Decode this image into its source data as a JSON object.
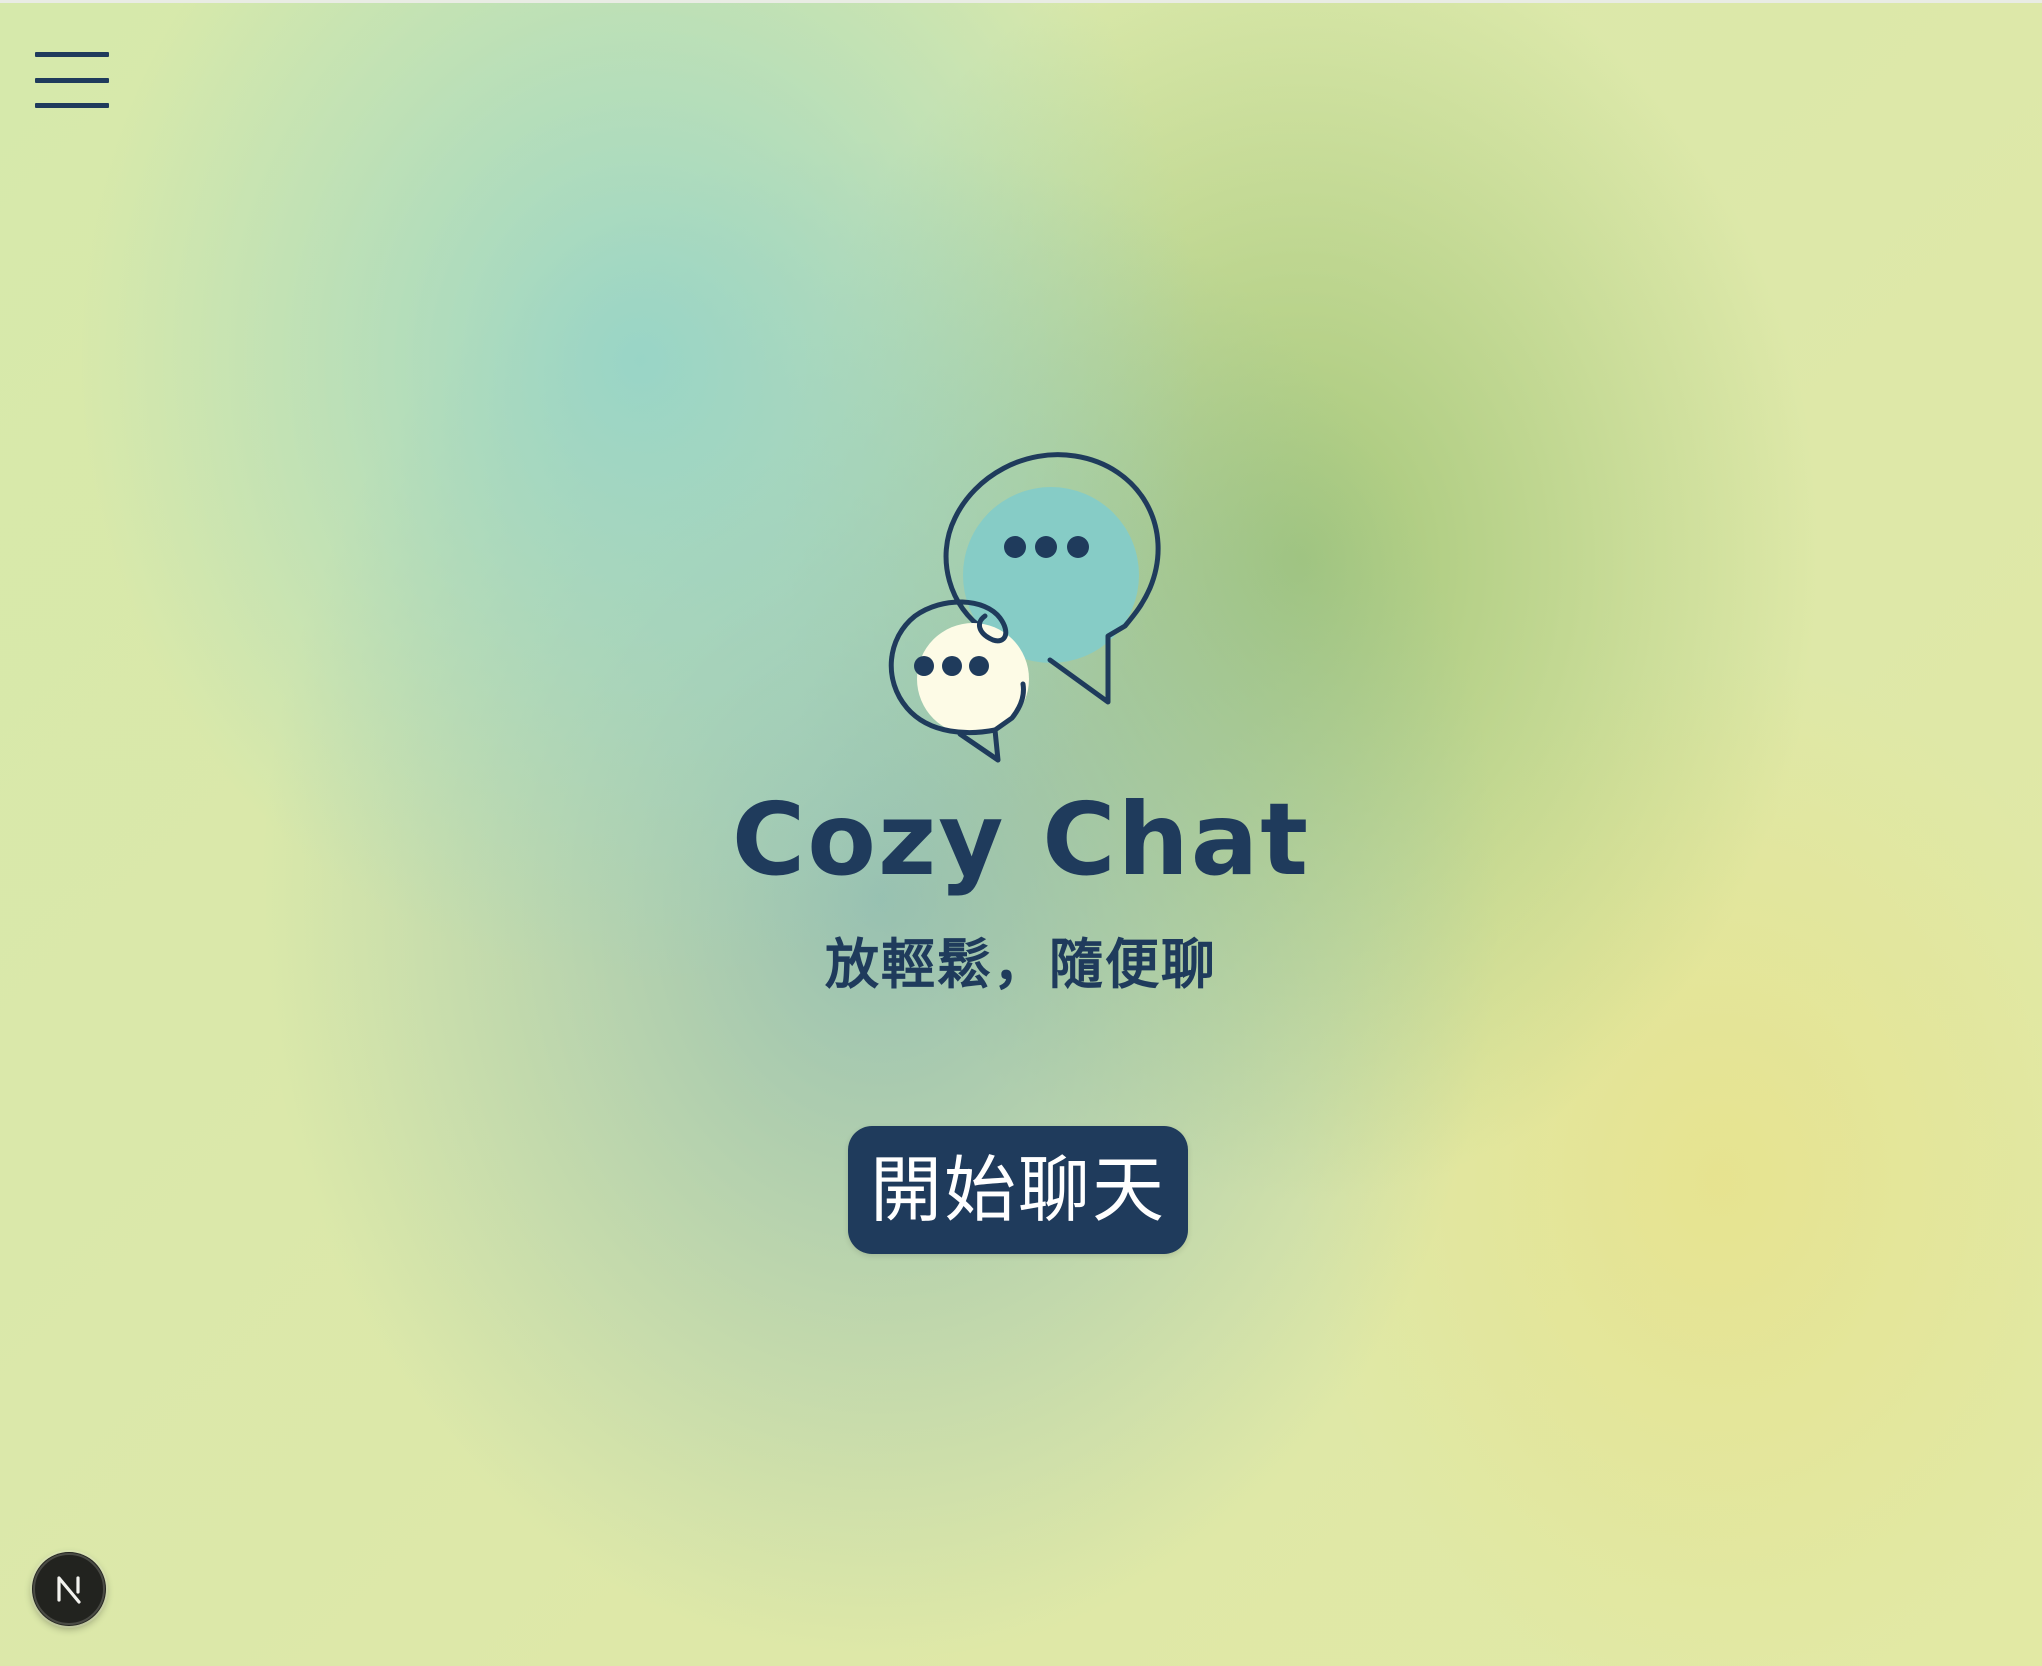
{
  "app": {
    "title": "Cozy Chat",
    "tagline": "放輕鬆，隨便聊"
  },
  "hero": {
    "logo_icon": "chat-bubbles-icon",
    "start_button_label": "開始聊天"
  },
  "nav": {
    "menu_icon": "hamburger-menu-icon"
  },
  "dev_badge": {
    "icon": "nextjs-logo-icon",
    "glyph": "N"
  },
  "colors": {
    "primary": "#1f3b5c",
    "bubble_large_fill": "#86ccc6",
    "bubble_small_fill": "#fdfbe6",
    "button_text": "#ffffff"
  }
}
